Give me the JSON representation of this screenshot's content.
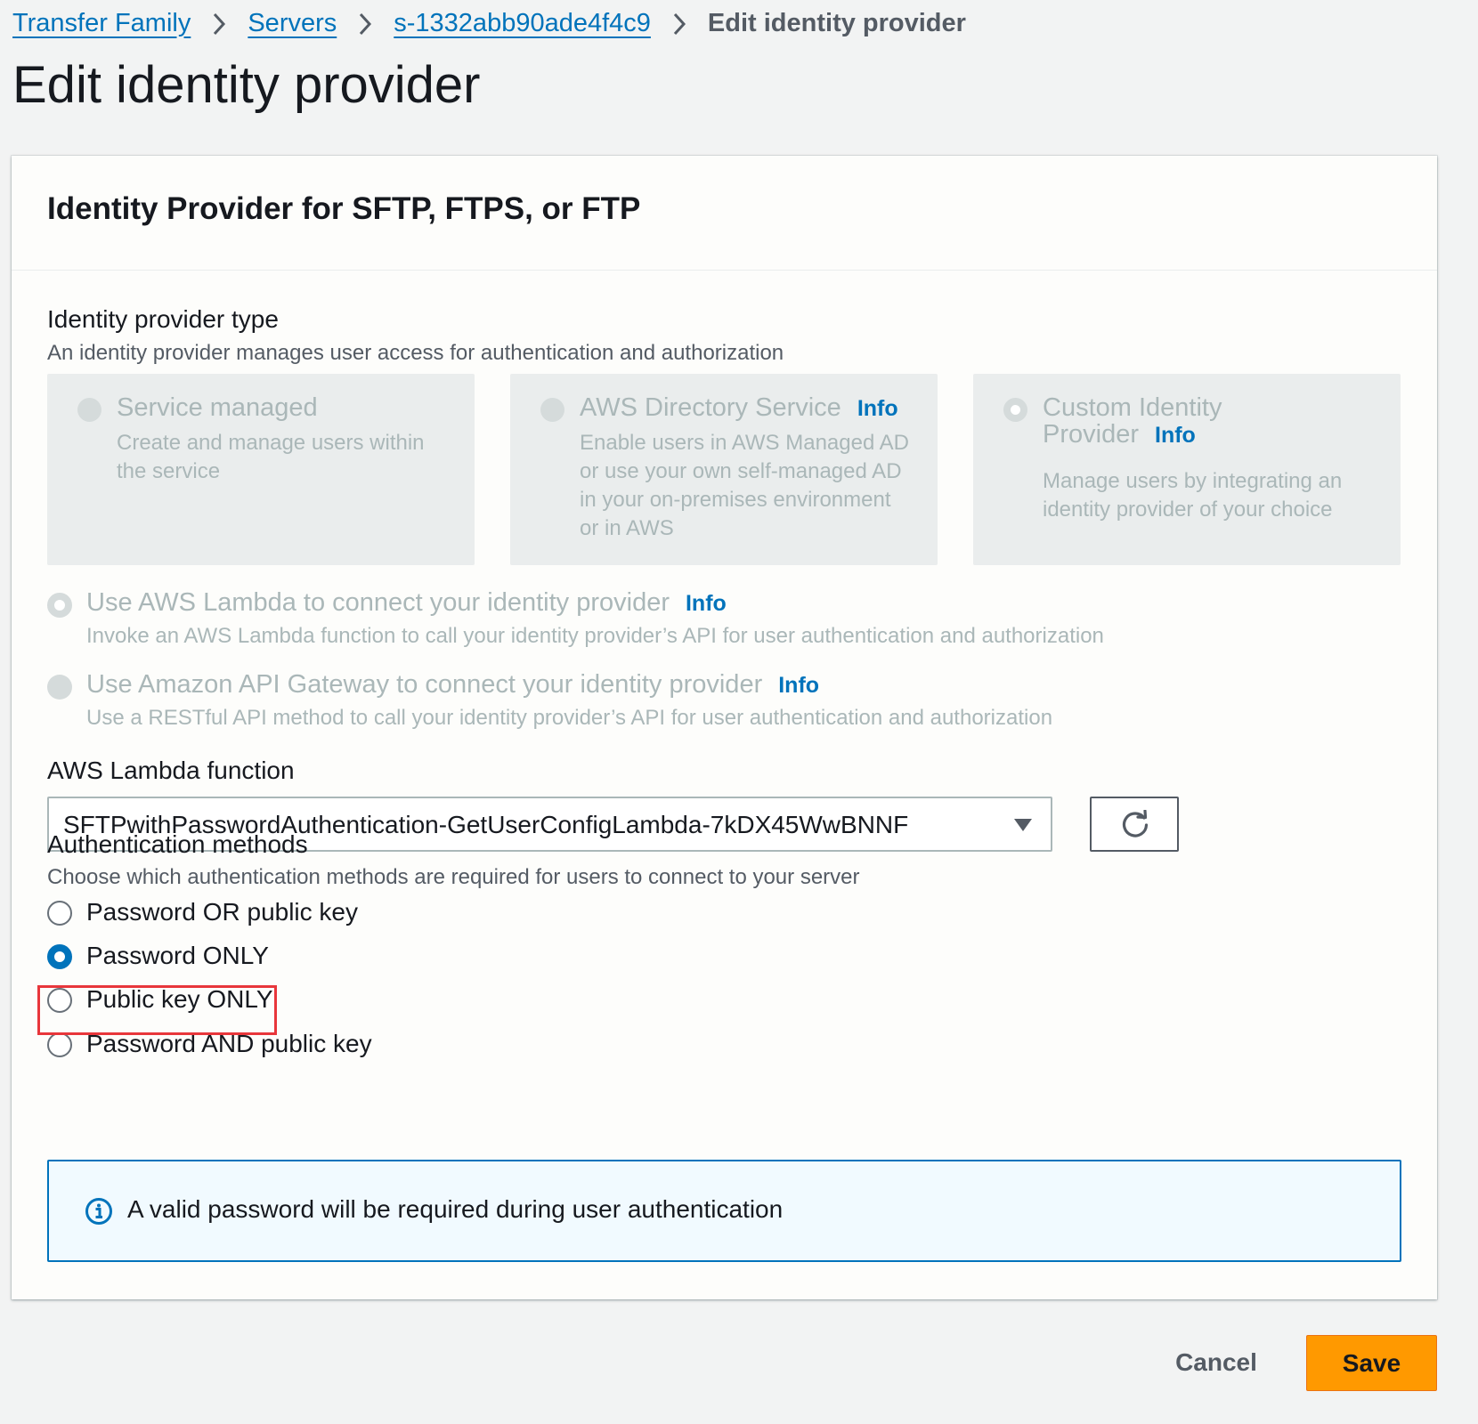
{
  "breadcrumb": {
    "items": [
      {
        "label": "Transfer Family"
      },
      {
        "label": "Servers"
      },
      {
        "label": "s-1332abb90ade4f4c9"
      }
    ],
    "current": "Edit identity provider"
  },
  "page_title": "Edit identity provider",
  "panel": {
    "title": "Identity Provider for SFTP, FTPS, or FTP",
    "provider_type": {
      "label": "Identity provider type",
      "description": "An identity provider manages user access for authentication and authorization",
      "tiles": [
        {
          "title": "Service managed",
          "description_lines": [
            "Create and manage users within",
            "the service"
          ],
          "selected": false
        },
        {
          "title": "AWS Directory Service",
          "info": "Info",
          "description_lines": [
            "Enable users in AWS Managed AD",
            "or use your own self-managed AD",
            "in your on-premises environment",
            "or in AWS"
          ],
          "selected": false
        },
        {
          "title_line1": "Custom Identity",
          "title_line2": "Provider",
          "info": "Info",
          "description_lines": [
            "Manage users by integrating an",
            "identity provider of your choice"
          ],
          "selected": true
        }
      ]
    },
    "custom_options": [
      {
        "title": "Use AWS Lambda to connect your identity provider",
        "info": "Info",
        "description": "Invoke an AWS Lambda function to call your identity provider’s API for user authentication and authorization",
        "selected": true
      },
      {
        "title": "Use Amazon API Gateway to connect your identity provider",
        "info": "Info",
        "description": "Use a RESTful API method to call your identity provider’s API for user authentication and authorization",
        "selected": false
      }
    ],
    "lambda": {
      "label": "AWS Lambda function",
      "selected_value": "SFTPwithPasswordAuthentication-GetUserConfigLambda-7kDX45WwBNNF"
    },
    "auth_methods": {
      "label": "Authentication methods",
      "description": "Choose which authentication methods are required for users to connect to your server",
      "options": [
        {
          "label": "Password OR public key",
          "selected": false
        },
        {
          "label": "Password ONLY",
          "selected": true
        },
        {
          "label": "Public key ONLY",
          "selected": false
        },
        {
          "label": "Password AND public key",
          "selected": false
        }
      ]
    },
    "alert": {
      "icon": "info-circle-icon",
      "text": "A valid password will be required during user authentication"
    }
  },
  "footer": {
    "cancel_label": "Cancel",
    "save_label": "Save"
  },
  "colors": {
    "link": "#0073bb",
    "primary_button": "#ff9900",
    "highlight": "#e8363b",
    "alert_border": "#0073bb",
    "alert_bg": "#f1faff"
  }
}
